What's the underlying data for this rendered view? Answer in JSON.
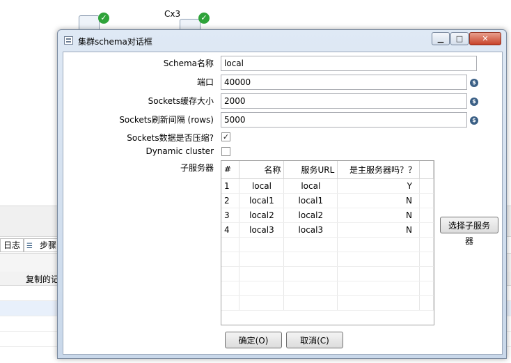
{
  "background": {
    "step_label": "Cx3",
    "tab_log": "日志",
    "tab_steps": "步骤",
    "grid_header_partial": "复制的记"
  },
  "dialog": {
    "title": "集群schema对话框",
    "window_buttons": {
      "minimize": "▁",
      "maximize": "□",
      "close": "✕"
    },
    "labels": {
      "schema_name": "Schema名称",
      "port": "端口",
      "buffer_size": "Sockets缓存大小",
      "flush_interval": "Sockets刷新间隔 (rows)",
      "compressed": "Sockets数据是否压缩?",
      "dynamic_cluster": "Dynamic cluster",
      "slave_servers": "子服务器"
    },
    "values": {
      "schema_name": "local",
      "port": "40000",
      "buffer_size": "2000",
      "flush_interval": "5000",
      "compressed": true,
      "dynamic_cluster": false
    },
    "table": {
      "columns": [
        "#",
        "名称",
        "服务URL",
        "是主服务器吗？？"
      ],
      "rows": [
        [
          "1",
          "local",
          "local",
          "Y"
        ],
        [
          "2",
          "local1",
          "local1",
          "N"
        ],
        [
          "3",
          "local2",
          "local2",
          "N"
        ],
        [
          "4",
          "local3",
          "local3",
          "N"
        ]
      ]
    },
    "buttons": {
      "select_slaves": "选择子服务器",
      "ok": "确定(O)",
      "cancel": "取消(C)"
    }
  }
}
